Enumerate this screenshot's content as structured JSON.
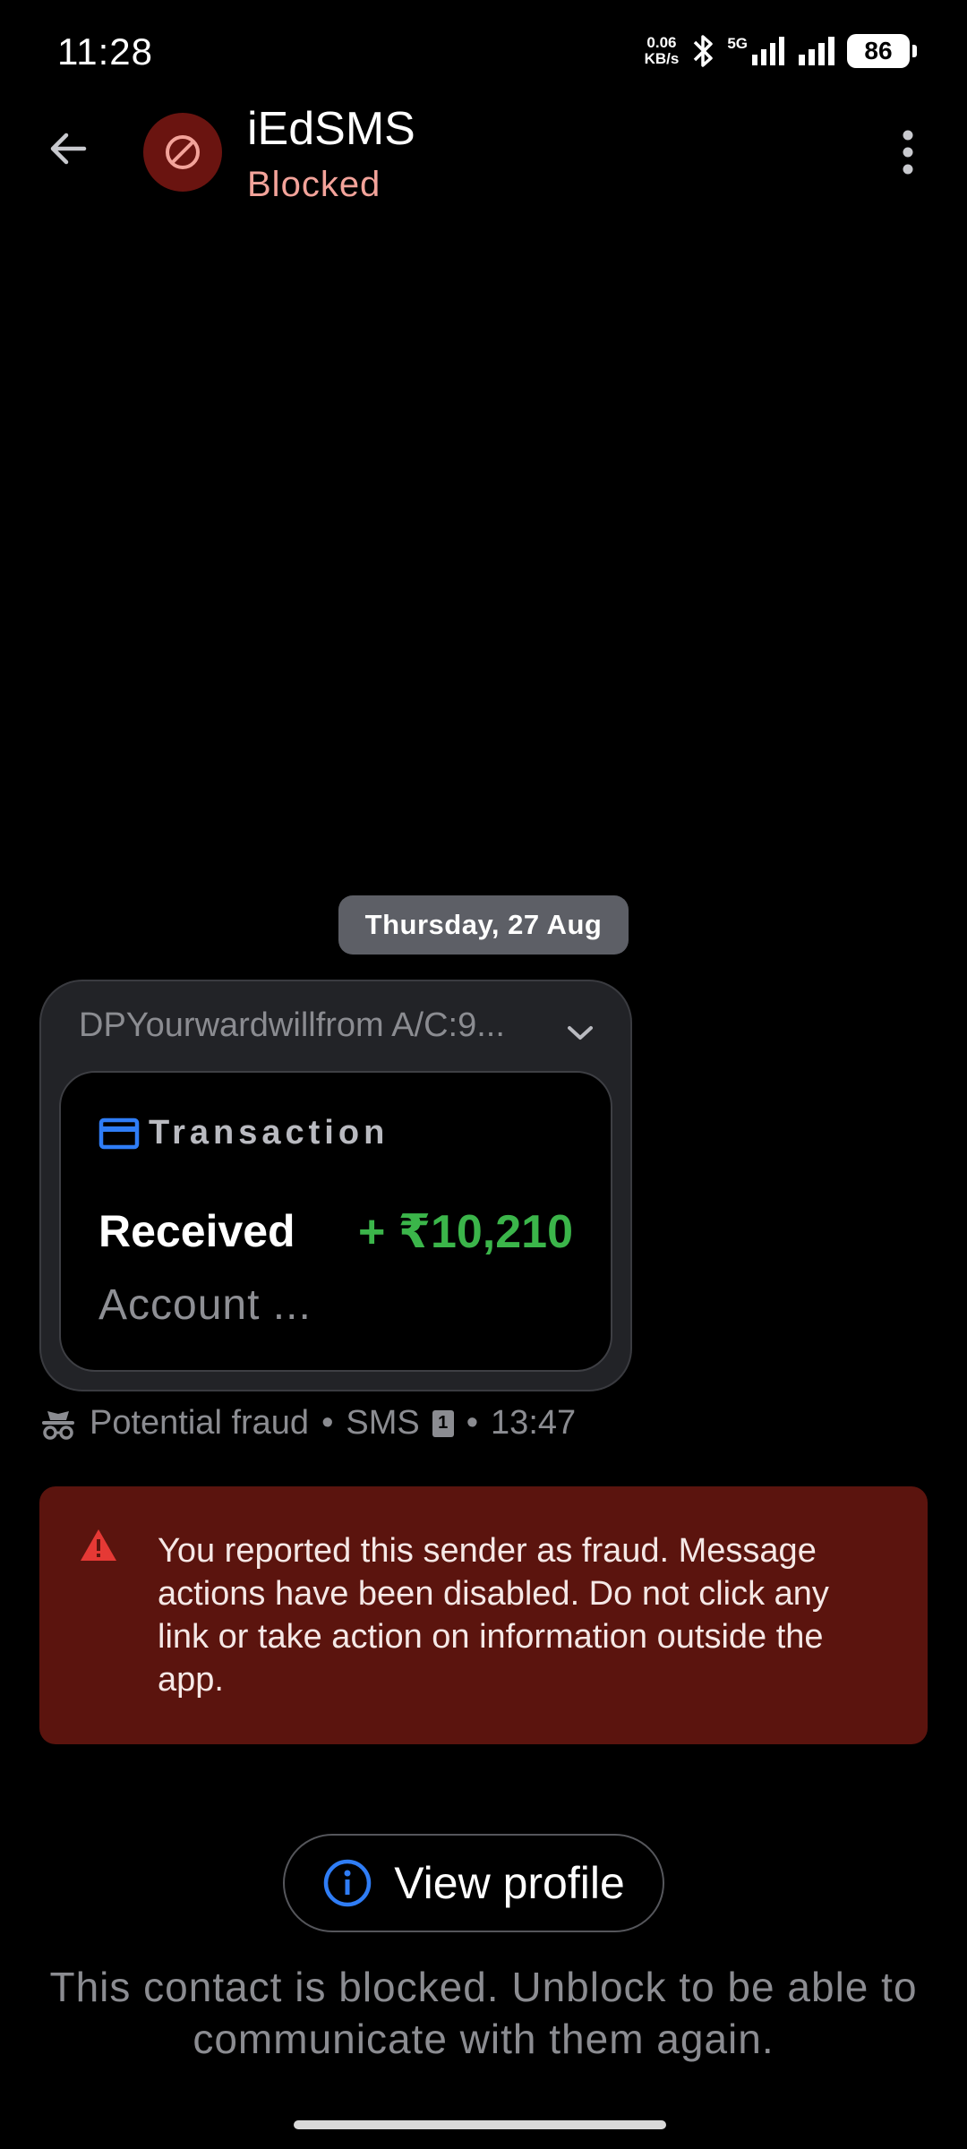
{
  "status_bar": {
    "time": "11:28",
    "net_speed_value": "0.06",
    "net_speed_unit": "KB/s",
    "network": "5G",
    "battery": "86"
  },
  "header": {
    "title": "iEdSMS",
    "subtitle": "Blocked",
    "avatar_icon": "blocked-icon"
  },
  "conversation": {
    "date_chip": "Thursday, 27 Aug",
    "message": {
      "preview": "DPYourwardwillfrom A/C:9...",
      "card_label": "Transaction",
      "transaction_type": "Received",
      "amount": "+ ₹10,210",
      "account_line": "Account ...",
      "meta": {
        "label": "Potential fraud",
        "channel": "SMS",
        "sim": "1",
        "time": "13:47"
      }
    }
  },
  "warning": {
    "text": "You reported this sender as fraud. Message actions have been disabled. Do not click any link or take action on information outside the app."
  },
  "profile_button": {
    "label": "View profile"
  },
  "blocked_note": "This contact is blocked. Unblock to be able to communicate with them again.",
  "colors": {
    "background": "#000000",
    "blocked_accent": "#f3a39a",
    "amount_green": "#3bb54a",
    "warning_bg": "#5b140e",
    "card_icon_blue": "#2f7df6"
  }
}
